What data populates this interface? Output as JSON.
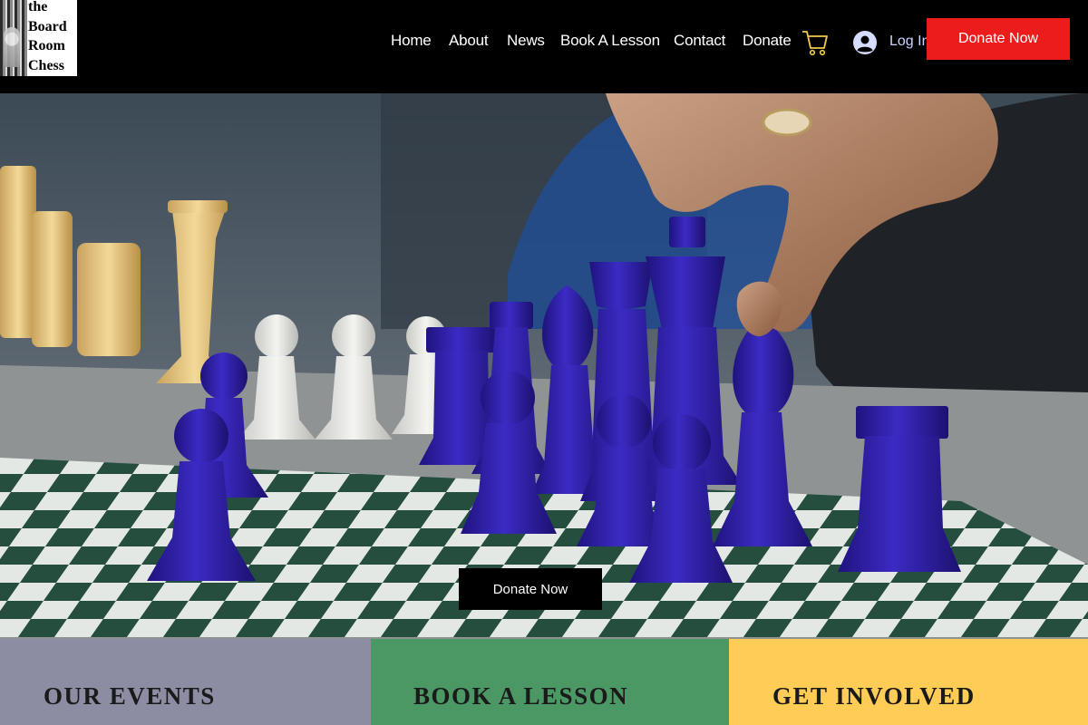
{
  "logo": {
    "lines": [
      "the",
      "Board",
      "Room",
      "Chess"
    ]
  },
  "nav": {
    "items": [
      {
        "label": "Home"
      },
      {
        "label": "About"
      },
      {
        "label": "News"
      },
      {
        "label": "Book A Lesson"
      },
      {
        "label": "Contact"
      },
      {
        "label": "Donate"
      }
    ]
  },
  "header": {
    "cart_icon": "shopping-cart-icon",
    "login_label": "Log In",
    "donate_label": "Donate Now"
  },
  "hero": {
    "image": "blue-and-cream-chess-pieces-photo",
    "donate_label": "Donate Now"
  },
  "panels": [
    {
      "title": "OUR EVENTS",
      "color": "#8c8ca2"
    },
    {
      "title": "BOOK A LESSON",
      "color": "#4b9864"
    },
    {
      "title": "GET INVOLVED",
      "color": "#ffcc55"
    }
  ],
  "colors": {
    "header_bg": "#000000",
    "donate_red": "#ec1c1c",
    "login_text": "#ccd6ff",
    "piece_blue": "#3524b4"
  }
}
